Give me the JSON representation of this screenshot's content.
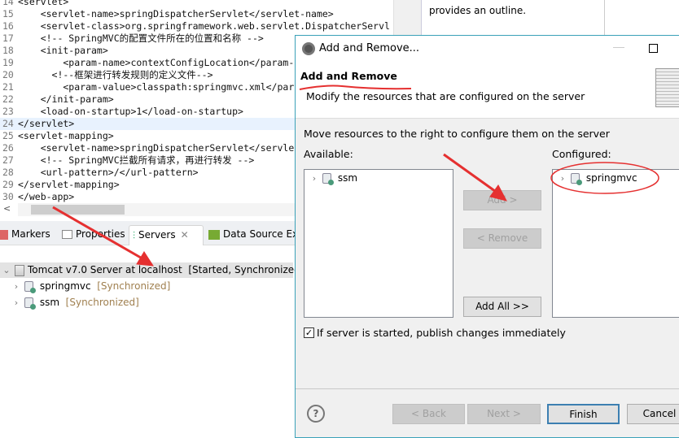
{
  "editor": {
    "lines": [
      {
        "n": "14",
        "code": "<servlet>"
      },
      {
        "n": "15",
        "code": "    <servlet-name>springDispatcherServlet</servlet-name>"
      },
      {
        "n": "16",
        "code": "    <servlet-class>org.springframework.web.servlet.DispatcherServl"
      },
      {
        "n": "17",
        "code": "    <!-- SpringMVC的配置文件所在的位置和名称 -->"
      },
      {
        "n": "18",
        "code": "    <init-param>"
      },
      {
        "n": "19",
        "code": "        <param-name>contextConfigLocation</param-"
      },
      {
        "n": "20",
        "code": "      <!--框架进行转发规则的定义文件-->"
      },
      {
        "n": "21",
        "code": "        <param-value>classpath:springmvc.xml</par"
      },
      {
        "n": "22",
        "code": "    </init-param>"
      },
      {
        "n": "23",
        "code": "    <load-on-startup>1</load-on-startup>"
      },
      {
        "n": "24",
        "code": "</servlet>"
      },
      {
        "n": "25",
        "code": "<servlet-mapping>"
      },
      {
        "n": "26",
        "code": "    <servlet-name>springDispatcherServlet</servlet-name>"
      },
      {
        "n": "27",
        "code": "    <!-- SpringMVC拦截所有请求，再进行转发 -->"
      },
      {
        "n": "28",
        "code": "    <url-pattern>/</url-pattern>"
      },
      {
        "n": "29",
        "code": "</servlet-mapping>"
      },
      {
        "n": "30",
        "code": "</web-app>"
      }
    ]
  },
  "outline": {
    "text": "provides an outline."
  },
  "tabs": [
    {
      "label": "Markers"
    },
    {
      "label": "Properties"
    },
    {
      "label": "Servers"
    },
    {
      "label": "Data Source Ex"
    }
  ],
  "servers": {
    "server": {
      "name": "Tomcat v7.0 Server at localhost",
      "status": "[Started, Synchronized]"
    },
    "modules": [
      {
        "name": "springmvc",
        "status": "[Synchronized]"
      },
      {
        "name": "ssm",
        "status": "[Synchronized]"
      }
    ]
  },
  "dialog": {
    "title": "Add and Remove...",
    "heading": "Add and Remove",
    "subtitle": "Modify the resources that are configured on the server",
    "instruction": "Move resources to the right to configure them on the server",
    "available_label": "Available:",
    "configured_label": "Configured:",
    "available": [
      "ssm"
    ],
    "configured": [
      "springmvc"
    ],
    "add": "Add >",
    "remove": "< Remove",
    "add_all": "Add All >>",
    "publish_checkbox": "If server is started, publish changes immediately",
    "publish_checked": true,
    "back": "< Back",
    "next": "Next >",
    "finish": "Finish",
    "cancel": "Cancel"
  },
  "annotation_color": "#e53030"
}
